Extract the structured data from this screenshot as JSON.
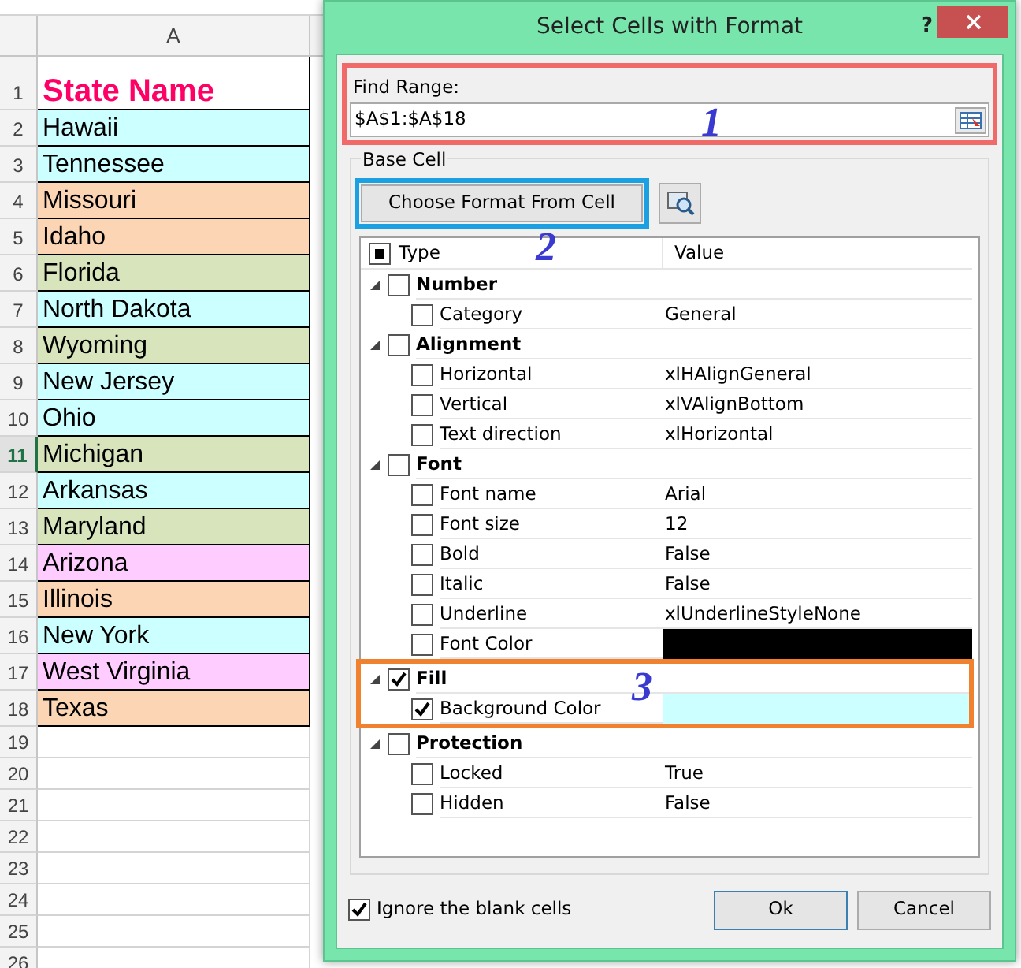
{
  "sheet": {
    "column_header": "A",
    "rows": [
      {
        "number": "1",
        "text": "State Name",
        "kind": "header",
        "selected": false
      },
      {
        "number": "2",
        "text": "Hawaii",
        "color": "#ccffff",
        "selected": false
      },
      {
        "number": "3",
        "text": "Tennessee",
        "color": "#ccffff",
        "selected": false
      },
      {
        "number": "4",
        "text": "Missouri",
        "color": "#fcd5b4",
        "selected": false
      },
      {
        "number": "5",
        "text": "Idaho",
        "color": "#fcd5b4",
        "selected": false
      },
      {
        "number": "6",
        "text": "Florida",
        "color": "#d8e4bc",
        "selected": false
      },
      {
        "number": "7",
        "text": "North Dakota",
        "color": "#ccffff",
        "selected": false
      },
      {
        "number": "8",
        "text": "Wyoming",
        "color": "#d8e4bc",
        "selected": false
      },
      {
        "number": "9",
        "text": "New Jersey",
        "color": "#ccffff",
        "selected": false
      },
      {
        "number": "10",
        "text": "Ohio",
        "color": "#ccffff",
        "selected": false
      },
      {
        "number": "11",
        "text": "Michigan",
        "color": "#d8e4bc",
        "selected": true
      },
      {
        "number": "12",
        "text": "Arkansas",
        "color": "#ccffff",
        "selected": false
      },
      {
        "number": "13",
        "text": "Maryland",
        "color": "#d8e4bc",
        "selected": false
      },
      {
        "number": "14",
        "text": "Arizona",
        "color": "#ffccff",
        "selected": false
      },
      {
        "number": "15",
        "text": "Illinois",
        "color": "#fcd5b4",
        "selected": false
      },
      {
        "number": "16",
        "text": "New York",
        "color": "#ccffff",
        "selected": false
      },
      {
        "number": "17",
        "text": "West Virginia",
        "color": "#ffccff",
        "selected": false
      },
      {
        "number": "18",
        "text": "Texas",
        "color": "#fcd5b4",
        "selected": false
      }
    ],
    "empty_rows": [
      "19",
      "20",
      "21",
      "22",
      "23",
      "24",
      "25",
      "26"
    ]
  },
  "dialog": {
    "title": "Select Cells with Format",
    "help": "?",
    "find_range": {
      "label": "Find Range:",
      "value": "$A$1:$A$18",
      "annotation": {
        "number": "1",
        "color": "#f06a6a"
      }
    },
    "base_cell": {
      "label": "Base Cell",
      "button": "Choose Format From Cell",
      "annotation": {
        "number": "2",
        "color": "#1ba1e2"
      }
    },
    "tree": {
      "header": {
        "type": "Type",
        "value": "Value",
        "checked": true
      },
      "groups": [
        {
          "label": "Number",
          "checked": false,
          "expanded": true,
          "children": [
            {
              "label": "Category",
              "checked": false,
              "value": "General",
              "kind": "text"
            }
          ]
        },
        {
          "label": "Alignment",
          "checked": false,
          "expanded": true,
          "children": [
            {
              "label": "Horizontal",
              "checked": false,
              "value": "xlHAlignGeneral",
              "kind": "text"
            },
            {
              "label": "Vertical",
              "checked": false,
              "value": "xlVAlignBottom",
              "kind": "text"
            },
            {
              "label": "Text direction",
              "checked": false,
              "value": "xlHorizontal",
              "kind": "text"
            }
          ]
        },
        {
          "label": "Font",
          "checked": false,
          "expanded": true,
          "children": [
            {
              "label": "Font name",
              "checked": false,
              "value": "Arial",
              "kind": "text"
            },
            {
              "label": "Font size",
              "checked": false,
              "value": "12",
              "kind": "text"
            },
            {
              "label": "Bold",
              "checked": false,
              "value": "False",
              "kind": "text"
            },
            {
              "label": "Italic",
              "checked": false,
              "value": "False",
              "kind": "text"
            },
            {
              "label": "Underline",
              "checked": false,
              "value": "xlUnderlineStyleNone",
              "kind": "text"
            },
            {
              "label": "Font Color",
              "checked": false,
              "color": "#000000",
              "kind": "color"
            }
          ]
        },
        {
          "label": "Fill",
          "checked": true,
          "expanded": true,
          "annotation": {
            "number": "3",
            "color": "#f0812e"
          },
          "children": [
            {
              "label": "Background Color",
              "checked": true,
              "color": "#ccffff",
              "kind": "color"
            }
          ]
        },
        {
          "label": "Protection",
          "checked": false,
          "expanded": true,
          "children": [
            {
              "label": "Locked",
              "checked": false,
              "value": "True",
              "kind": "text"
            },
            {
              "label": "Hidden",
              "checked": false,
              "value": "False",
              "kind": "text"
            }
          ]
        }
      ]
    },
    "ignore_blank": {
      "label": "Ignore the blank cells",
      "checked": true
    },
    "buttons": [
      "Ok",
      "Cancel"
    ]
  }
}
